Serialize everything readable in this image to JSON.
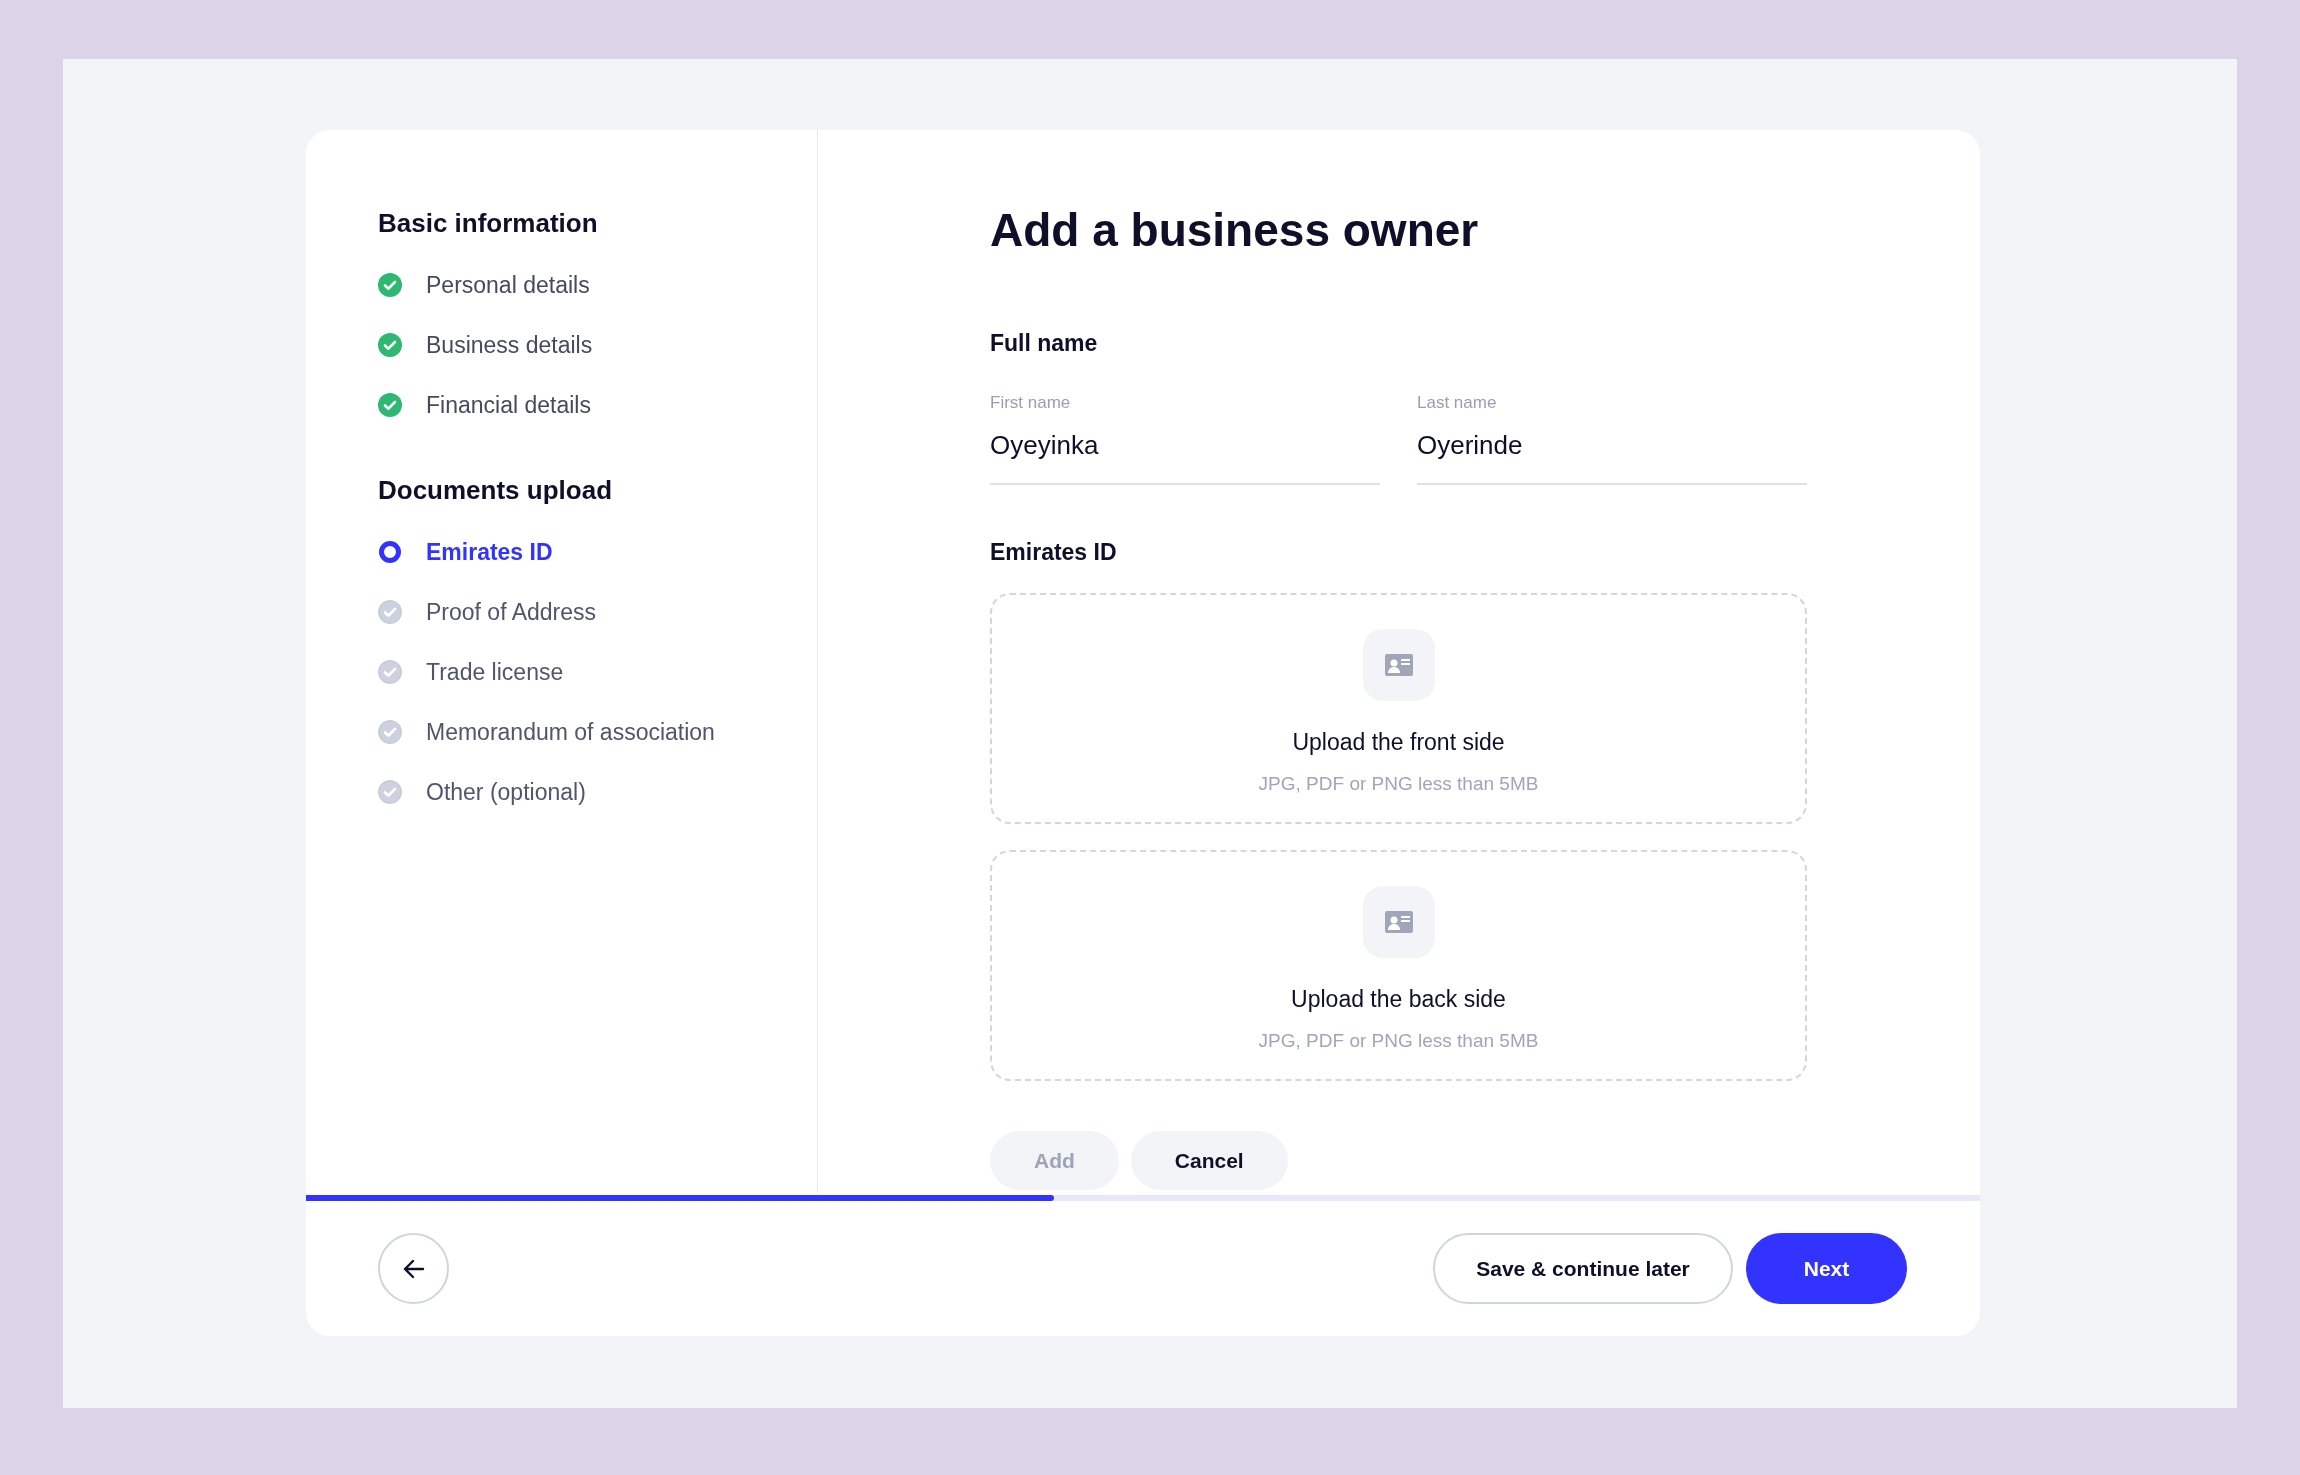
{
  "sidebar": {
    "sections": [
      {
        "title": "Basic information",
        "items": [
          {
            "label": "Personal details",
            "completed": true,
            "selected": false
          },
          {
            "label": "Business details",
            "completed": true,
            "selected": false
          },
          {
            "label": "Financial details",
            "completed": true,
            "selected": false
          }
        ]
      },
      {
        "title": "Documents upload",
        "items": [
          {
            "label": "Emirates ID",
            "completed": false,
            "selected": true
          },
          {
            "label": "Proof of Address",
            "completed": false,
            "selected": false
          },
          {
            "label": "Trade license",
            "completed": false,
            "selected": false
          },
          {
            "label": "Memorandum of association",
            "completed": false,
            "selected": false
          },
          {
            "label": "Other (optional)",
            "completed": false,
            "selected": false
          }
        ]
      }
    ]
  },
  "form": {
    "title": "Add a business owner",
    "full_name": {
      "label": "Full name",
      "fields": [
        {
          "label": "First name",
          "value": "Oyeyinka"
        },
        {
          "label": "Last name",
          "value": "Oyerinde"
        }
      ]
    },
    "emirates_id": {
      "label": "Emirates ID",
      "uploads": [
        {
          "title": "Upload the front side",
          "hint": "JPG, PDF or PNG less than 5MB"
        },
        {
          "title": "Upload the back side",
          "hint": "JPG, PDF or PNG less than 5MB"
        }
      ]
    },
    "buttons": [
      {
        "label": "Add",
        "disabled": true
      },
      {
        "label": "Cancel",
        "disabled": false
      }
    ]
  },
  "progress": {
    "level": 0.447
  },
  "footer": {
    "save_button": "Save & continue later",
    "next_button": "Next"
  }
}
